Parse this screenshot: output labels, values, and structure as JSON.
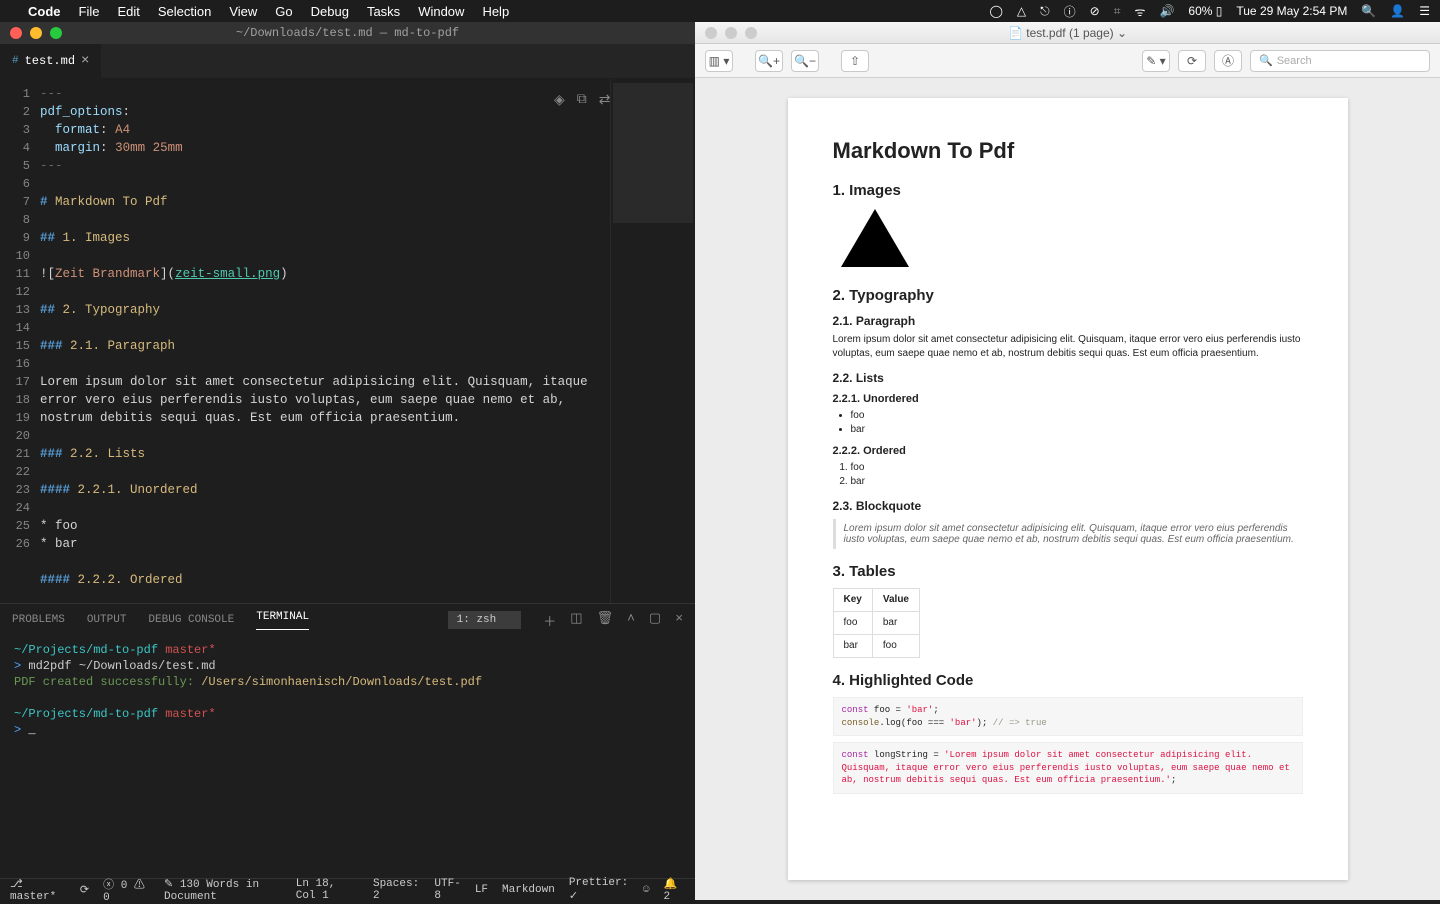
{
  "menubar": {
    "app": "Code",
    "items": [
      "File",
      "Edit",
      "Selection",
      "View",
      "Go",
      "Debug",
      "Tasks",
      "Window",
      "Help"
    ],
    "right": {
      "battery": "60%",
      "datetime": "Tue 29 May  2:54 PM"
    }
  },
  "vscode": {
    "title": "~/Downloads/test.md — md-to-pdf",
    "tab": {
      "icon": "#",
      "name": "test.md"
    },
    "editor": {
      "lines": [
        {
          "n": 1,
          "html": "<span class='c-gray'>---</span>"
        },
        {
          "n": 2,
          "html": "<span class='c-field'>pdf_options</span><span class='c-plain'>:</span>"
        },
        {
          "n": 3,
          "html": "  <span class='c-field'>format</span><span class='c-plain'>:</span> <span class='c-val'>A4</span>"
        },
        {
          "n": 4,
          "html": "  <span class='c-field'>margin</span><span class='c-plain'>:</span> <span class='c-val'>30mm 25mm</span>"
        },
        {
          "n": 5,
          "html": "<span class='c-gray'>---</span>"
        },
        {
          "n": 6,
          "html": ""
        },
        {
          "n": 7,
          "html": "<span class='c-head'># </span><span class='c-strong'>Markdown To Pdf</span>"
        },
        {
          "n": 8,
          "html": ""
        },
        {
          "n": 9,
          "html": "<span class='c-head'>## </span><span class='c-strong'>1. Images</span>"
        },
        {
          "n": 10,
          "html": ""
        },
        {
          "n": 11,
          "html": "<span class='c-plain'>![</span><span class='c-val'>Zeit Brandmark</span><span class='c-plain'>](</span><span class='c-link'>zeit-small.png</span><span class='c-plain'>)</span>"
        },
        {
          "n": 12,
          "html": ""
        },
        {
          "n": 13,
          "html": "<span class='c-head'>## </span><span class='c-strong'>2. Typography</span>"
        },
        {
          "n": 14,
          "html": ""
        },
        {
          "n": 15,
          "html": "<span class='c-head'>### </span><span class='c-strong'>2.1. Paragraph</span>"
        },
        {
          "n": 16,
          "html": ""
        },
        {
          "n": 17,
          "html": "<span class='c-plain'>Lorem ipsum dolor sit amet consectetur adipisicing elit. Quisquam, itaque\nerror vero eius perferendis iusto voluptas, eum saepe quae nemo et ab,\nnostrum debitis sequi quas. Est eum officia praesentium.</span>"
        },
        {
          "n": 18,
          "html": ""
        },
        {
          "n": 19,
          "html": "<span class='c-head'>### </span><span class='c-strong'>2.2. Lists</span>"
        },
        {
          "n": 20,
          "html": ""
        },
        {
          "n": 21,
          "html": "<span class='c-head'>#### </span><span class='c-strong'>2.2.1. Unordered</span>"
        },
        {
          "n": 22,
          "html": ""
        },
        {
          "n": 23,
          "html": "<span class='c-plain'>* foo</span>"
        },
        {
          "n": 24,
          "html": "<span class='c-plain'>* bar</span>"
        },
        {
          "n": 25,
          "html": ""
        },
        {
          "n": 26,
          "html": "<span class='c-head'>#### </span><span class='c-strong'>2.2.2. Ordered</span>"
        }
      ]
    },
    "panel": {
      "tabs": [
        "PROBLEMS",
        "OUTPUT",
        "DEBUG CONSOLE",
        "TERMINAL"
      ],
      "active": "TERMINAL",
      "termSelect": "1: zsh",
      "terminal": [
        {
          "html": "<span class='t-cyan'>~/Projects/md-to-pdf</span> <span class='t-red'>master*</span>"
        },
        {
          "html": "<span class='t-blue'>&gt;</span> md2pdf ~/Downloads/test.md"
        },
        {
          "html": "<span class='t-green'>PDF created successfully:</span> <span class='t-yellow'>/Users/simonhaenisch/Downloads/test.pdf</span>"
        },
        {
          "html": ""
        },
        {
          "html": "<span class='t-cyan'>~/Projects/md-to-pdf</span> <span class='t-red'>master*</span>"
        },
        {
          "html": "<span class='t-blue'>&gt;</span> <span style='color:#fff;'>_</span>"
        }
      ]
    },
    "status": {
      "branch": "master*",
      "errors": "0",
      "warnings": "0",
      "words": "130 Words in Document",
      "lncol": "Ln 18, Col 1",
      "spaces": "Spaces: 2",
      "encoding": "UTF-8",
      "eol": "LF",
      "lang": "Markdown",
      "prettier": "Prettier: ✓",
      "notif": "2"
    }
  },
  "preview": {
    "title": "test.pdf (1 page) ⌄",
    "search_placeholder": "Search",
    "doc": {
      "h1": "Markdown To Pdf",
      "s1": "1. Images",
      "s2": "2. Typography",
      "s21": "2.1. Paragraph",
      "para": "Lorem ipsum dolor sit amet consectetur adipisicing elit. Quisquam, itaque error vero eius perferendis iusto voluptas, eum saepe quae nemo et ab, nostrum debitis sequi quas. Est eum officia praesentium.",
      "s22": "2.2. Lists",
      "s221": "2.2.1. Unordered",
      "ul": [
        "foo",
        "bar"
      ],
      "s222": "2.2.2. Ordered",
      "ol": [
        "foo",
        "bar"
      ],
      "s23": "2.3. Blockquote",
      "bq": "Lorem ipsum dolor sit amet consectetur adipisicing elit. Quisquam, itaque error vero eius perferendis iusto voluptas, eum saepe quae nemo et ab, nostrum debitis sequi quas. Est eum officia praesentium.",
      "s3": "3. Tables",
      "table": {
        "head": [
          "Key",
          "Value"
        ],
        "rows": [
          [
            "foo",
            "bar"
          ],
          [
            "bar",
            "foo"
          ]
        ]
      },
      "s4": "4. Highlighted Code",
      "code1": "<span class='hl-kw'>const</span> foo = <span class='hl-str'>'bar'</span>;\n<span class='hl-fn'>console</span>.log(foo === <span class='hl-str'>'bar'</span>); <span class='hl-com'>// =&gt; true</span>",
      "code2": "<span class='hl-kw'>const</span> longString = <span class='hl-str'>'Lorem ipsum dolor sit amet consectetur adipisicing elit. Quisquam, itaque error vero eius perferendis iusto voluptas, eum saepe quae nemo et ab, nostrum debitis sequi quas. Est eum officia praesentium.'</span>;"
    }
  }
}
